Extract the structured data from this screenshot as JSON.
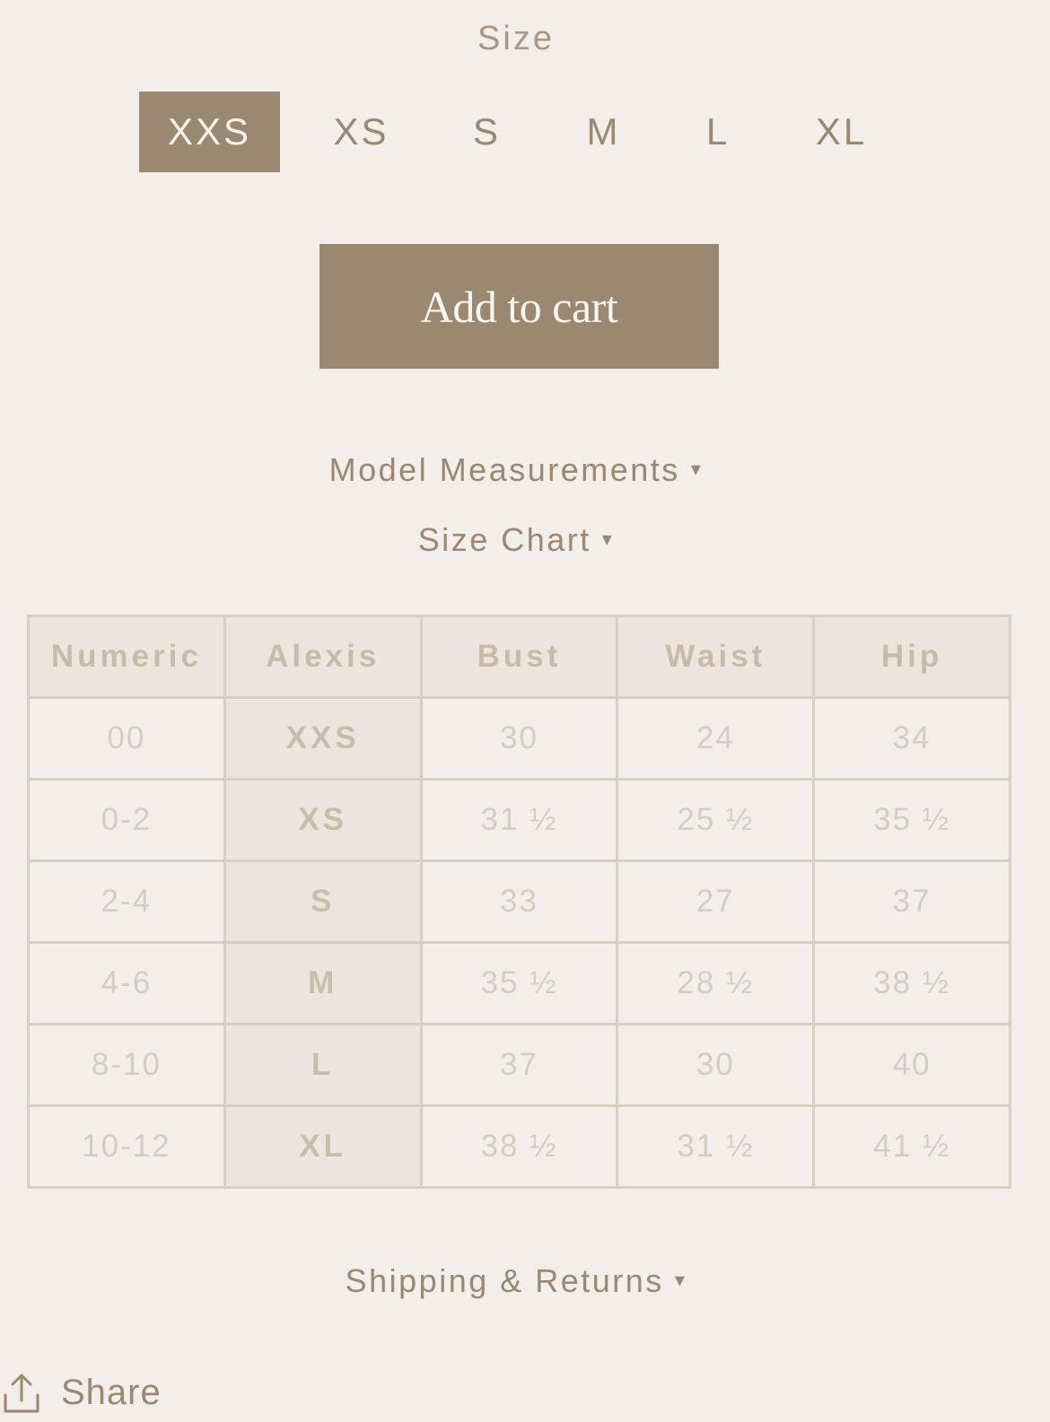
{
  "size_selector": {
    "heading": "Size",
    "options": [
      "XXS",
      "XS",
      "S",
      "M",
      "L",
      "XL"
    ],
    "selected": "XXS"
  },
  "add_to_cart": {
    "label": "Add to cart"
  },
  "accordions": {
    "model_measurements": "Model Measurements",
    "size_chart": "Size Chart",
    "shipping_returns": "Shipping & Returns",
    "caret": "▾"
  },
  "size_chart": {
    "headers": [
      "Numeric",
      "Alexis",
      "Bust",
      "Waist",
      "Hip"
    ],
    "rows": [
      [
        "00",
        "XXS",
        "30",
        "24",
        "34"
      ],
      [
        "0-2",
        "XS",
        "31 ½",
        "25 ½",
        "35 ½"
      ],
      [
        "2-4",
        "S",
        "33",
        "27",
        "37"
      ],
      [
        "4-6",
        "M",
        "35 ½",
        "28 ½",
        "38 ½"
      ],
      [
        "8-10",
        "L",
        "37",
        "30",
        "40"
      ],
      [
        "10-12",
        "XL",
        "38 ½",
        "31 ½",
        "41 ½"
      ]
    ]
  },
  "share": {
    "label": "Share",
    "icon": "share-upload-icon"
  },
  "colors": {
    "accent": "#9b8870",
    "background": "#f3eee9",
    "table_border": "#d8cfc2",
    "table_header_bg": "#ede5dd"
  }
}
